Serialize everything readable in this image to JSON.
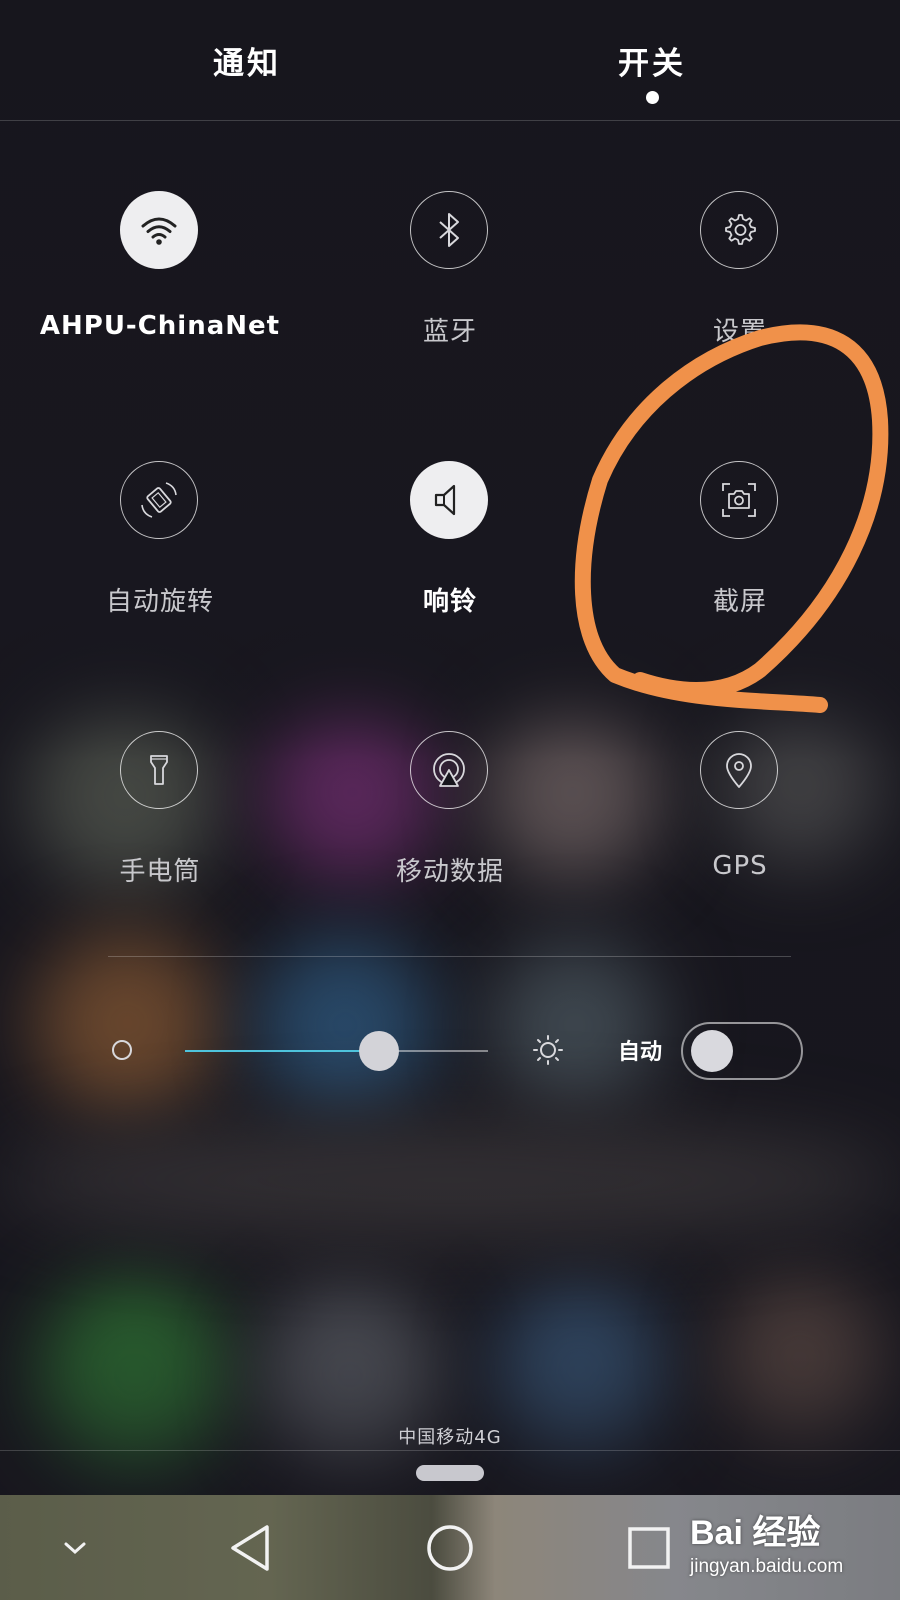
{
  "header": {
    "tabs": [
      {
        "label": "通知",
        "active": false
      },
      {
        "label": "开关",
        "active": true
      }
    ]
  },
  "toggles": [
    {
      "label": "AHPU-ChinaNet",
      "icon": "wifi-icon",
      "on": true
    },
    {
      "label": "蓝牙",
      "icon": "bluetooth-icon",
      "on": false
    },
    {
      "label": "设置",
      "icon": "gear-icon",
      "on": false
    },
    {
      "label": "自动旋转",
      "icon": "rotate-icon",
      "on": false
    },
    {
      "label": "响铃",
      "icon": "speaker-icon",
      "on": true
    },
    {
      "label": "截屏",
      "icon": "screenshot-camera-icon",
      "on": false
    },
    {
      "label": "手电筒",
      "icon": "flashlight-icon",
      "on": false
    },
    {
      "label": "移动数据",
      "icon": "mobile-data-icon",
      "on": false
    },
    {
      "label": "GPS",
      "icon": "location-pin-icon",
      "on": false
    }
  ],
  "brightness": {
    "level": 0.64,
    "auto_label": "自动",
    "auto_enabled": false
  },
  "status": {
    "carrier": "中国移动4G"
  },
  "navbar": {
    "buttons": [
      "collapse-chevron-icon",
      "back-triangle-icon",
      "home-circle-icon",
      "recents-square-icon"
    ]
  },
  "watermark": {
    "brand": "Bai 经验",
    "url": "jingyan.baidu.com"
  },
  "colors": {
    "accent": "#4ec3dc",
    "annotation": "#f0914a",
    "panel_bg": "#17161d"
  }
}
